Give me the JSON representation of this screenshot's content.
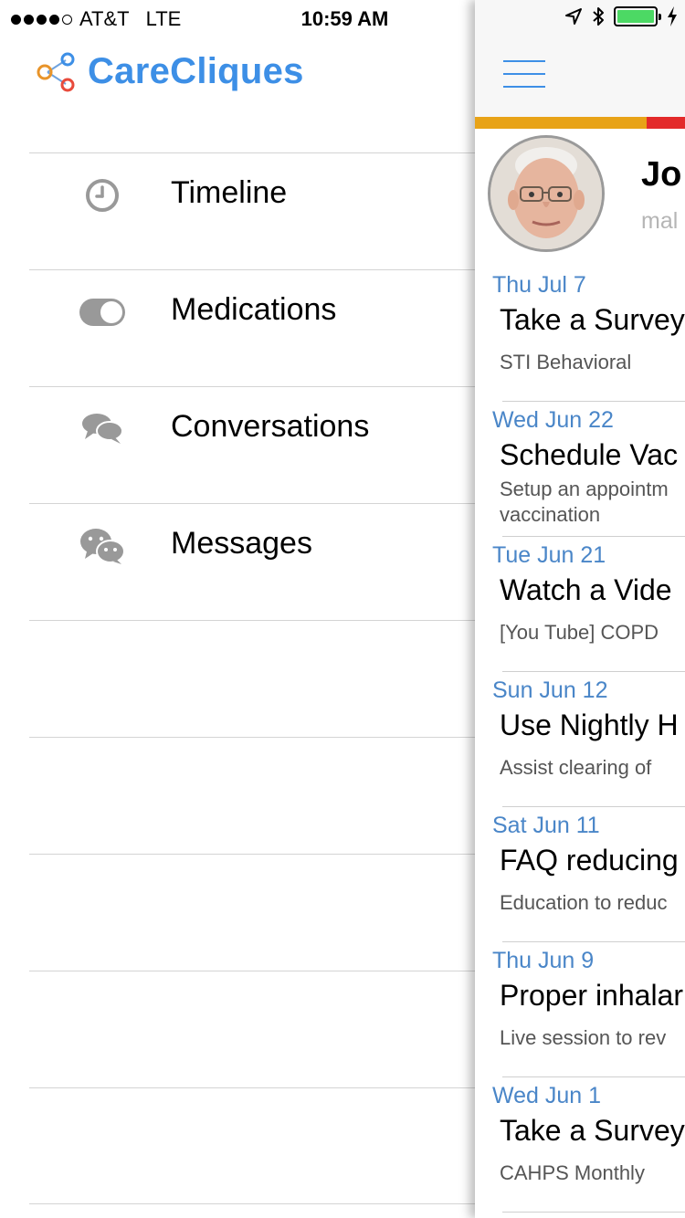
{
  "status_bar": {
    "carrier": "AT&T",
    "network": "LTE",
    "time": "10:59 AM",
    "signal_bars_filled": 4,
    "signal_bars_total": 5,
    "battery_level": 1.0
  },
  "app": {
    "title": "CareCliques",
    "brand_color": "#3d8fe6"
  },
  "menu": {
    "items": [
      {
        "label": "Timeline",
        "icon": "clock-icon"
      },
      {
        "label": "Medications",
        "icon": "toggle-icon"
      },
      {
        "label": "Conversations",
        "icon": "chat-bubbles-icon"
      },
      {
        "label": "Messages",
        "icon": "wechat-icon"
      }
    ]
  },
  "patient": {
    "name": "Jo",
    "subtitle": "mal"
  },
  "timeline": [
    {
      "date": "Thu Jul 7",
      "title": "Take a Survey",
      "desc": "STI Behavioral"
    },
    {
      "date": "Wed Jun 22",
      "title": "Schedule Vac",
      "desc_line1": "Setup an appointm",
      "desc_line2": "vaccination"
    },
    {
      "date": "Tue Jun 21",
      "title": "Watch a Vide",
      "desc": "[You Tube] COPD"
    },
    {
      "date": "Sun Jun 12",
      "title": "Use Nightly H",
      "desc": "Assist clearing of"
    },
    {
      "date": "Sat Jun 11",
      "title": "FAQ reducing",
      "desc": "Education to reduc"
    },
    {
      "date": "Thu Jun 9",
      "title": "Proper inhalar",
      "desc": "Live session to rev"
    },
    {
      "date": "Wed Jun 1",
      "title": "Take a Survey",
      "desc": "CAHPS Monthly"
    }
  ],
  "colors": {
    "date_text": "#4a86c8",
    "strip_orange": "#e8a317",
    "strip_red": "#e32a2a",
    "battery_fill": "#4cd964"
  }
}
